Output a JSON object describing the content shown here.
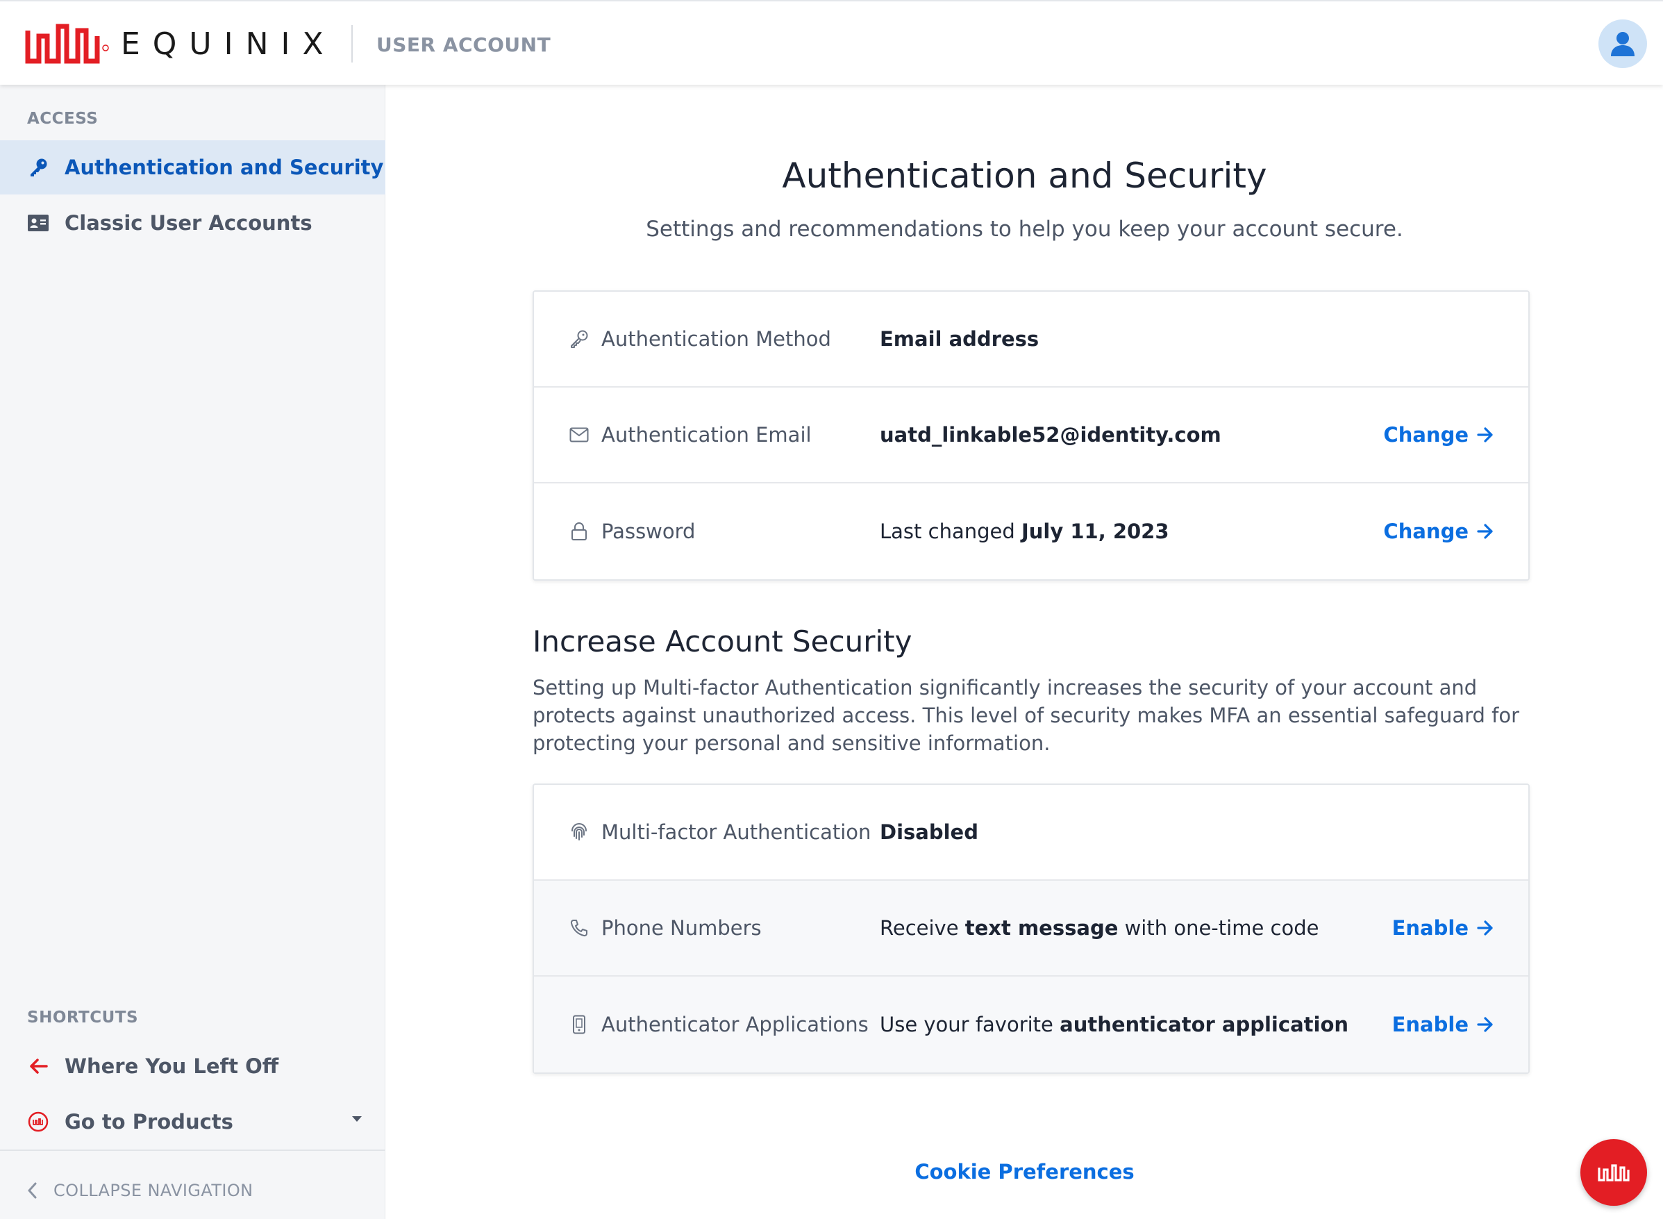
{
  "header": {
    "brand": "EQUINIX",
    "section": "USER ACCOUNT",
    "avatar_icon": "user-icon"
  },
  "sidebar": {
    "access_heading": "ACCESS",
    "items": [
      {
        "label": "Authentication and Security",
        "icon": "key-icon",
        "active": true
      },
      {
        "label": "Classic User Accounts",
        "icon": "id-card-icon",
        "active": false
      }
    ],
    "shortcuts_heading": "SHORTCUTS",
    "shortcuts": [
      {
        "label": "Where You Left Off",
        "icon": "arrow-left-icon"
      },
      {
        "label": "Go to Products",
        "icon": "equinix-logo-icon"
      }
    ],
    "collapse_label": "COLLAPSE NAVIGATION"
  },
  "main": {
    "title": "Authentication and Security",
    "subtitle": "Settings and recommendations to help you keep your account secure.",
    "auth_card": {
      "method": {
        "label": "Authentication Method",
        "value": "Email address"
      },
      "email": {
        "label": "Authentication Email",
        "value": "uatd_linkable52@identity.com",
        "action": "Change"
      },
      "password": {
        "label": "Password",
        "value_prefix": "Last changed",
        "value_date": "July 11, 2023",
        "action": "Change"
      }
    },
    "security_title": "Increase Account Security",
    "security_text": "Setting up Multi-factor Authentication significantly increases the security of your account and protects against unauthorized access. This level of security makes MFA an essential safeguard for protecting your personal and sensitive information.",
    "mfa_card": {
      "mfa": {
        "label": "Multi-factor Authentication",
        "value": "Disabled"
      },
      "phone": {
        "label": "Phone Numbers",
        "value_prefix": "Receive",
        "value_bold": "text message",
        "value_suffix": "with one-time code",
        "action": "Enable"
      },
      "app": {
        "label": "Authenticator Applications",
        "value_prefix": "Use your favorite",
        "value_bold": "authenticator application",
        "action": "Enable"
      }
    },
    "cookie_label": "Cookie Preferences"
  },
  "colors": {
    "brand_red": "#e31e24",
    "link_blue": "#0b6ee0",
    "active_blue": "#0b57b8",
    "sidebar_bg": "#f5f6f8",
    "active_bg": "#dde8f5"
  }
}
